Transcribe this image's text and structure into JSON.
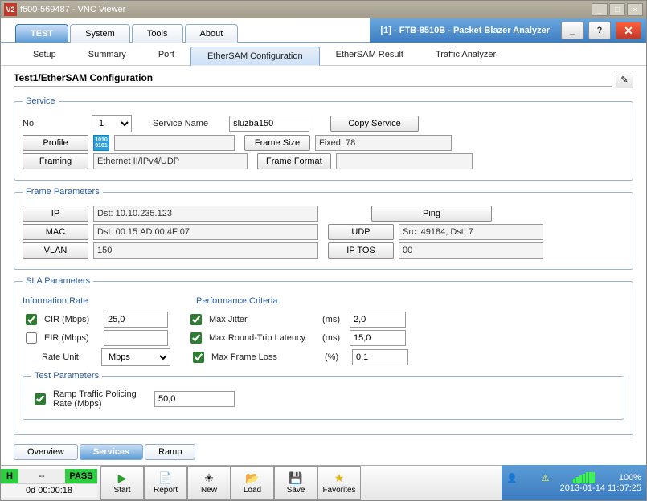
{
  "vnc": {
    "title": "f500-569487 - VNC Viewer"
  },
  "app": {
    "header_title": "[1] - FTB-8510B - Packet Blazer Analyzer"
  },
  "main_tabs": [
    "TEST",
    "System",
    "Tools",
    "About"
  ],
  "sub_tabs": [
    "Setup",
    "Summary",
    "Port",
    "EtherSAM Configuration",
    "EtherSAM Result",
    "Traffic Analyzer"
  ],
  "page": {
    "title": "Test1/EtherSAM Configuration"
  },
  "service": {
    "legend": "Service",
    "no_label": "No.",
    "no_value": "1",
    "name_label": "Service Name",
    "name_value": "sluzba150",
    "copy_label": "Copy Service",
    "profile_label": "Profile",
    "frame_size_label": "Frame Size",
    "frame_size_value": "Fixed, 78",
    "framing_label": "Framing",
    "framing_value": "Ethernet II/IPv4/UDP",
    "frame_format_label": "Frame Format"
  },
  "frame": {
    "legend": "Frame Parameters",
    "ip_label": "IP",
    "ip_value": "Dst: 10.10.235.123",
    "ping_label": "Ping",
    "mac_label": "MAC",
    "mac_value": "Dst: 00:15:AD:00:4F:07",
    "udp_label": "UDP",
    "udp_value": "Src: 49184, Dst: 7",
    "vlan_label": "VLAN",
    "vlan_value": "150",
    "iptos_label": "IP TOS",
    "iptos_value": "00"
  },
  "sla": {
    "legend": "SLA Parameters",
    "info_rate_label": "Information Rate",
    "perf_label": "Performance Criteria",
    "cir_label": "CIR (Mbps)",
    "cir_value": "25,0",
    "eir_label": "EIR (Mbps)",
    "rate_unit_label": "Rate Unit",
    "rate_unit_value": "Mbps",
    "jitter_label": "Max Jitter",
    "jitter_value": "2,0",
    "latency_label": "Max Round-Trip Latency",
    "latency_value": "15,0",
    "frameloss_label": "Max Frame Loss",
    "frameloss_value": "0,1",
    "ms_unit": "(ms)",
    "pct_unit": "(%)",
    "test_legend": "Test Parameters",
    "ramp_label": "Ramp Traffic Policing Rate (Mbps)",
    "ramp_value": "50,0"
  },
  "bottom_tabs": [
    "Overview",
    "Services",
    "Ramp"
  ],
  "toolbar": [
    "Start",
    "Report",
    "New",
    "Load",
    "Save",
    "Favorites"
  ],
  "status": {
    "h": "H",
    "mid": "--",
    "pass": "PASS",
    "elapsed": "0d 00:00:18",
    "battery": "100%",
    "datetime": "2013-01-14 11:07:25"
  }
}
